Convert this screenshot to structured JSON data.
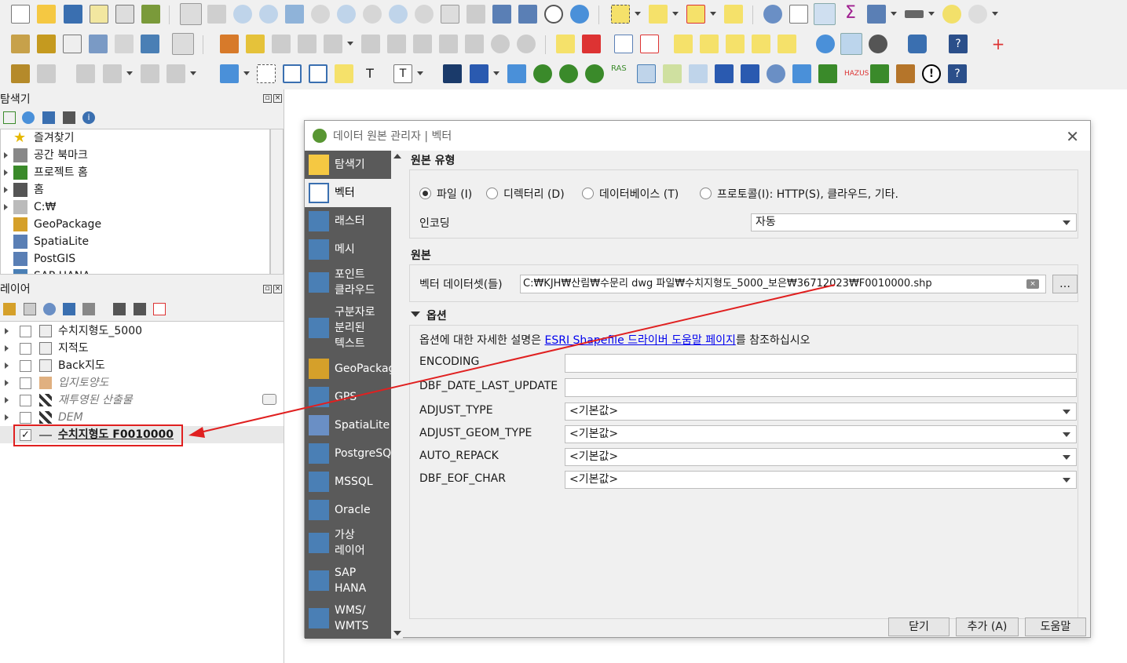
{
  "colors": {
    "sidebar_bg": "#5a5a5a",
    "annotation_red": "#e02020",
    "link_blue": "#0000ee"
  },
  "browser_panel": {
    "title": "탐색기",
    "items": [
      {
        "label": "즐겨찾기",
        "icon": "star-icon",
        "expander": false
      },
      {
        "label": "공간 북마크",
        "icon": "bookmark-icon",
        "expander": true
      },
      {
        "label": "프로젝트 홈",
        "icon": "project-home-icon",
        "expander": true
      },
      {
        "label": "홈",
        "icon": "home-icon",
        "expander": true
      },
      {
        "label": "C:₩",
        "icon": "folder-icon",
        "expander": true
      },
      {
        "label": "GeoPackage",
        "icon": "geopackage-icon",
        "expander": false
      },
      {
        "label": "SpatiaLite",
        "icon": "spatialite-icon",
        "expander": false
      },
      {
        "label": "PostGIS",
        "icon": "postgis-icon",
        "expander": false
      },
      {
        "label": "SAP HANA",
        "icon": "sap-hana-icon",
        "expander": false
      }
    ]
  },
  "layers_panel": {
    "title": "레이어",
    "layers": [
      {
        "label": "수치지형도_5000",
        "checked": false,
        "italic": false,
        "icon": "group-icon"
      },
      {
        "label": "지적도",
        "checked": false,
        "italic": false,
        "icon": "group-icon"
      },
      {
        "label": "Back지도",
        "checked": false,
        "italic": false,
        "icon": "group-icon"
      },
      {
        "label": "입지토양도",
        "checked": false,
        "italic": true,
        "icon": "polygon-layer-icon"
      },
      {
        "label": "재투영된 산출물",
        "checked": false,
        "italic": true,
        "icon": "raster-layer-icon"
      },
      {
        "label": "DEM",
        "checked": false,
        "italic": true,
        "icon": "raster-layer-icon"
      },
      {
        "label": "수치지형도 F0010000",
        "checked": true,
        "italic": false,
        "icon": "line-layer-icon"
      }
    ]
  },
  "dialog": {
    "title": "데이터 원본 관리자 | 벡터",
    "sidebar": [
      {
        "label": "탐색기",
        "icon": "folder-icon"
      },
      {
        "label": "벡터",
        "icon": "vector-icon",
        "active": true
      },
      {
        "label": "래스터",
        "icon": "raster-icon"
      },
      {
        "label": "메시",
        "icon": "mesh-icon"
      },
      {
        "label": "포인트\n클라우드",
        "icon": "point-cloud-icon"
      },
      {
        "label": "구분자로\n분리된\n텍스트",
        "icon": "delimited-text-icon"
      },
      {
        "label": "GeoPackage",
        "icon": "geopackage-icon"
      },
      {
        "label": "GPS",
        "icon": "gps-icon"
      },
      {
        "label": "SpatiaLite",
        "icon": "spatialite-icon"
      },
      {
        "label": "PostgreSQL",
        "icon": "postgresql-icon"
      },
      {
        "label": "MSSQL",
        "icon": "mssql-icon"
      },
      {
        "label": "Oracle",
        "icon": "oracle-icon"
      },
      {
        "label": "가상\n레이어",
        "icon": "virtual-layer-icon"
      },
      {
        "label": "SAP\nHANA",
        "icon": "sap-hana-icon"
      },
      {
        "label": "WMS/\nWMTS",
        "icon": "wms-icon"
      }
    ],
    "source_type": {
      "title": "원본 유형",
      "options": [
        "파일 (I)",
        "디렉터리 (D)",
        "데이터베이스 (T)",
        "프로토콜(I): HTTP(S), 클라우드, 기타."
      ],
      "selected": "파일 (I)",
      "encoding_label": "인코딩",
      "encoding_value": "자동"
    },
    "source": {
      "title": "원본",
      "dataset_label": "벡터 데이터셋(들)",
      "dataset_value": "C:₩KJH₩산림₩수문리 dwg 파일₩수치지형도_5000_보은₩36712023₩F0010000.shp",
      "browse_label": "…"
    },
    "options": {
      "title": "옵션",
      "help_prefix": "옵션에 대한 자세한 설명은 ",
      "help_link": "ESRI Shapefile 드라이버 도움말 페이지",
      "help_suffix": "를 참조하십시오",
      "fields": [
        {
          "label": "ENCODING",
          "type": "text",
          "value": ""
        },
        {
          "label": "DBF_DATE_LAST_UPDATE",
          "type": "text",
          "value": ""
        },
        {
          "label": "ADJUST_TYPE",
          "type": "combo",
          "value": "<기본값>"
        },
        {
          "label": "ADJUST_GEOM_TYPE",
          "type": "combo",
          "value": "<기본값>"
        },
        {
          "label": "AUTO_REPACK",
          "type": "combo",
          "value": "<기본값>"
        },
        {
          "label": "DBF_EOF_CHAR",
          "type": "combo",
          "value": "<기본값>"
        }
      ]
    },
    "buttons": {
      "close": "닫기",
      "add": "추가 (A)",
      "help": "도움말"
    }
  }
}
